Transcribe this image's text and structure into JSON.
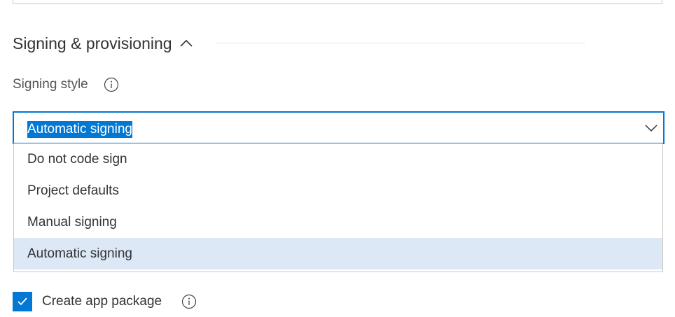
{
  "section": {
    "title": "Signing & provisioning"
  },
  "signing_style": {
    "label": "Signing style",
    "selected_value": "Automatic signing",
    "options": [
      "Do not code sign",
      "Project defaults",
      "Manual signing",
      "Automatic signing"
    ],
    "selected_index": 3
  },
  "create_package": {
    "label": "Create app package",
    "checked": true
  },
  "colors": {
    "accent": "#0078d4",
    "selected_option_bg": "#dce8f5",
    "text": "#333333",
    "border": "#c8c8c8"
  },
  "icons": {
    "section_toggle": "chevron-up-icon",
    "info": "info-icon",
    "dropdown": "chevron-down-icon",
    "check": "checkmark-icon"
  }
}
